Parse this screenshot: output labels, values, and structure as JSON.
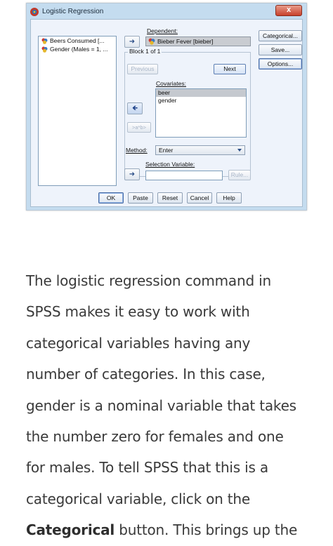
{
  "window": {
    "title": "Logistic Regression",
    "close_label": "x"
  },
  "variable_list": [
    {
      "label": "Beers Consumed [..."
    },
    {
      "label": "Gender (Males = 1, ..."
    }
  ],
  "dependent": {
    "label": "Dependent:",
    "value": "Bieber Fever [bieber]"
  },
  "block": {
    "label": "Block 1 of 1",
    "previous_label": "Previous",
    "next_label": "Next"
  },
  "covariates": {
    "label": "Covariates:",
    "items": [
      "beer",
      "gender"
    ],
    "interaction_label": ">a*b>"
  },
  "method": {
    "label": "Method:",
    "value": "Enter"
  },
  "selection_variable": {
    "label": "Selection Variable:",
    "value": "",
    "rule_label": "Rule..."
  },
  "side_buttons": {
    "categorical": "Categorical...",
    "save": "Save...",
    "options": "Options..."
  },
  "bottom_buttons": {
    "ok": "OK",
    "paste": "Paste",
    "reset": "Reset",
    "cancel": "Cancel",
    "help": "Help"
  },
  "article": {
    "lines": [
      "The logistic regression command in",
      "SPSS makes it easy to work with",
      "categorical variables having any",
      "number of categories. In this case,",
      "gender is a nominal variable that takes",
      "the number zero for females and one",
      "for males. To tell SPSS that this is a",
      "categorical variable, click on the"
    ],
    "last_line_bold": "Categorical",
    "last_line_rest": " button. This brings up the"
  },
  "colors": {
    "dialog_frame": "#c4dcef",
    "client_bg": "#eef3fb",
    "close_button": "#c8412b",
    "text": "#3a3a3a"
  }
}
